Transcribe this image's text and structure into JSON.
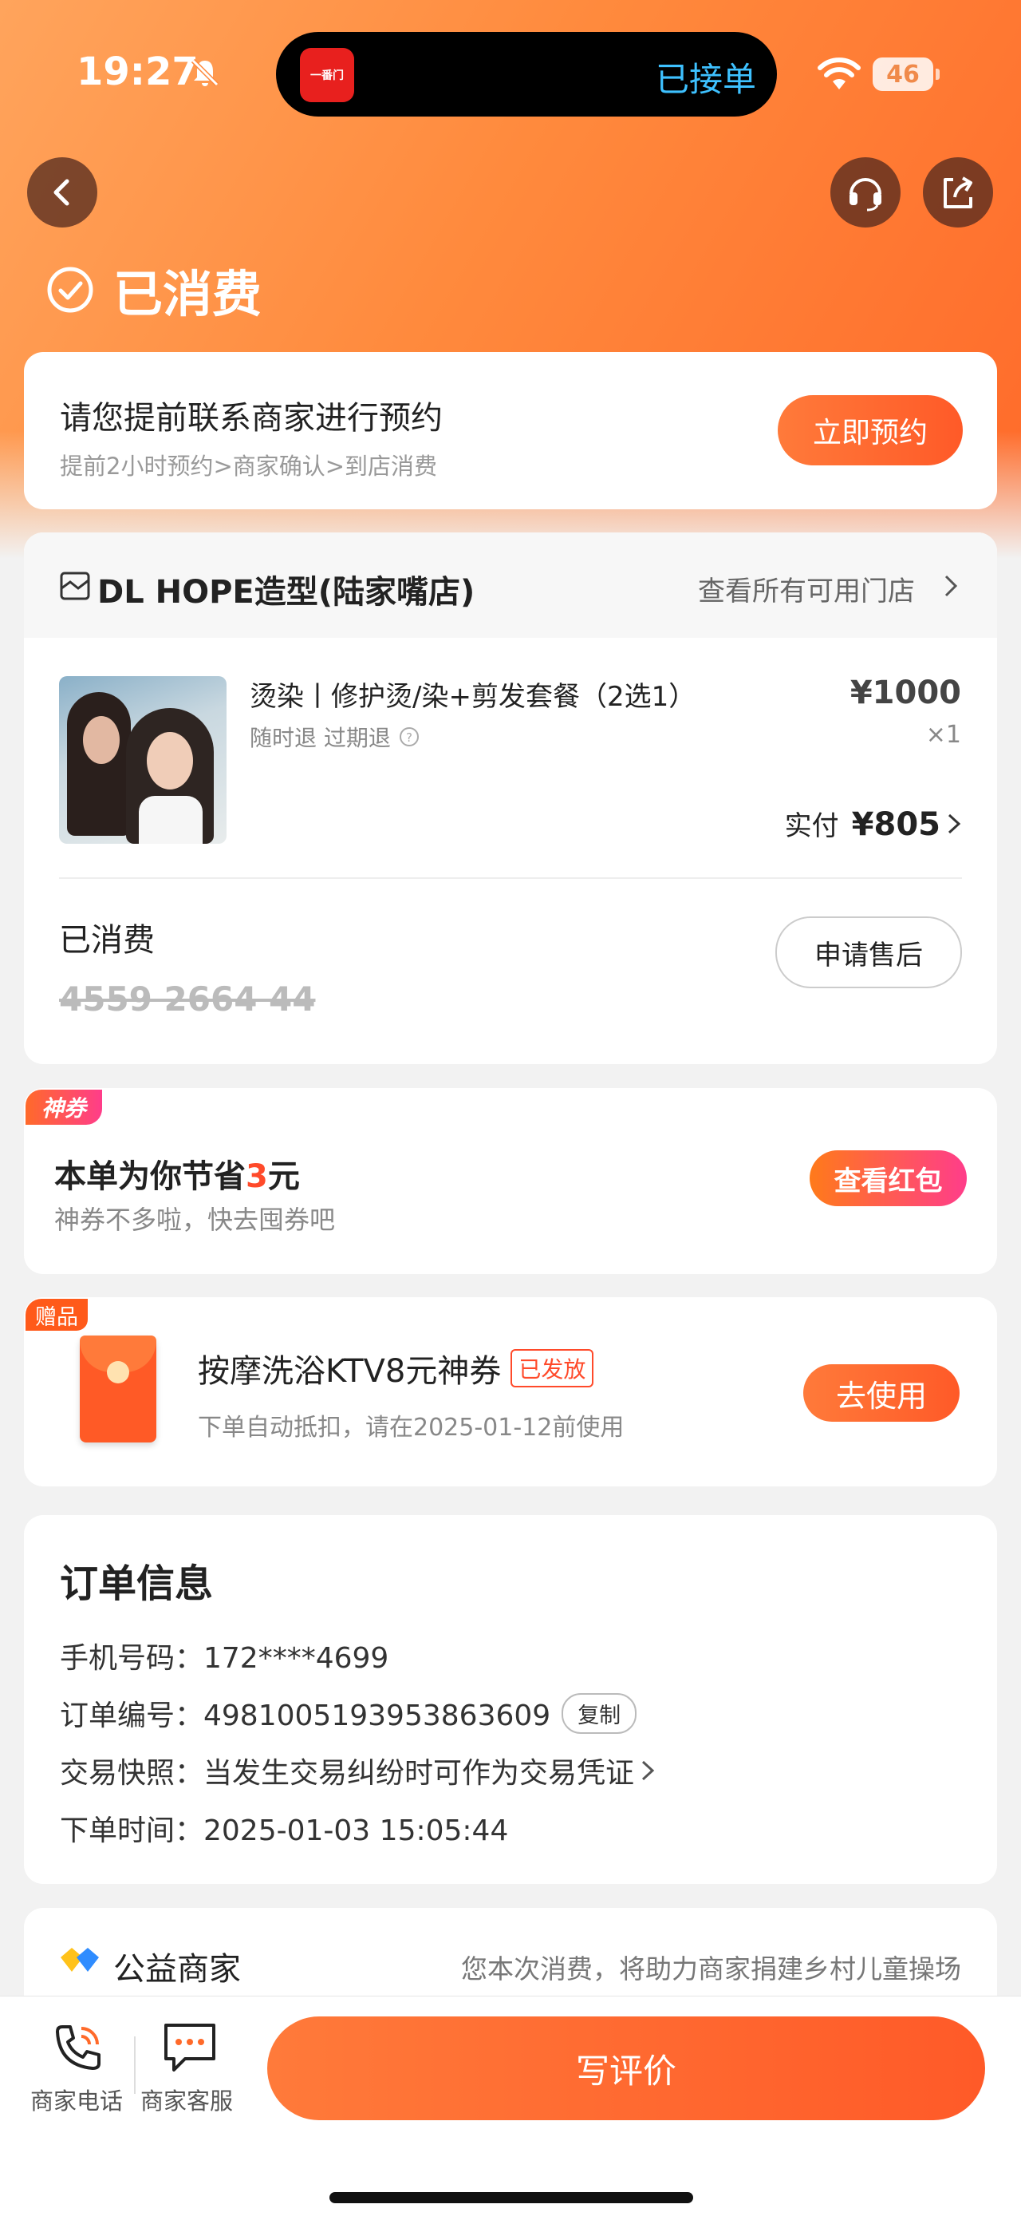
{
  "status_bar": {
    "time": "19:27",
    "island_text": "已接单",
    "battery": "46",
    "app_icon_text": "一番门"
  },
  "header": {
    "status_title": "已消费"
  },
  "reserve": {
    "title": "请您提前联系商家进行预约",
    "steps": "提前2小时预约>商家确认>到店消费",
    "button": "立即预约"
  },
  "store": {
    "name": "DL HOPE造型(陆家嘴店)",
    "view_all": "查看所有可用门店"
  },
  "product": {
    "title": "烫染丨修护烫/染+剪发套餐（2选1）",
    "tags": "随时退 过期退",
    "price": "¥1000",
    "qty": "×1",
    "paid_label": "实付",
    "paid_amount": "¥805"
  },
  "voucher": {
    "status": "已消费",
    "code": "4559 2664 44",
    "after_sale": "申请售后"
  },
  "coupon": {
    "badge": "神券",
    "title_prefix": "本单为你节省",
    "amount": "3",
    "title_suffix": "元",
    "subtitle": "神券不多啦，快去囤券吧",
    "button": "查看红包"
  },
  "gift": {
    "badge": "赠品",
    "title": "按摩洗浴KTV8元神券",
    "tag": "已发放",
    "subtitle": "下单自动抵扣，请在2025-01-12前使用",
    "button": "去使用"
  },
  "order": {
    "title": "订单信息",
    "phone": "手机号码：172****4699",
    "number": "订单编号：4981005193953863609",
    "copy": "复制",
    "snapshot": "交易快照：当发生交易纠纷时可作为交易凭证",
    "time": "下单时间：2025-01-03 15:05:44"
  },
  "charity": {
    "title": "公益商家",
    "desc": "您本次消费，将助力商家捐建乡村儿童操场"
  },
  "bottom": {
    "phone": "商家电话",
    "service": "商家客服",
    "review": "写评价"
  },
  "colors": {
    "accent": "#ff6a2a",
    "price_red": "#ff4a2a",
    "link_blue": "#3ec1ff"
  }
}
